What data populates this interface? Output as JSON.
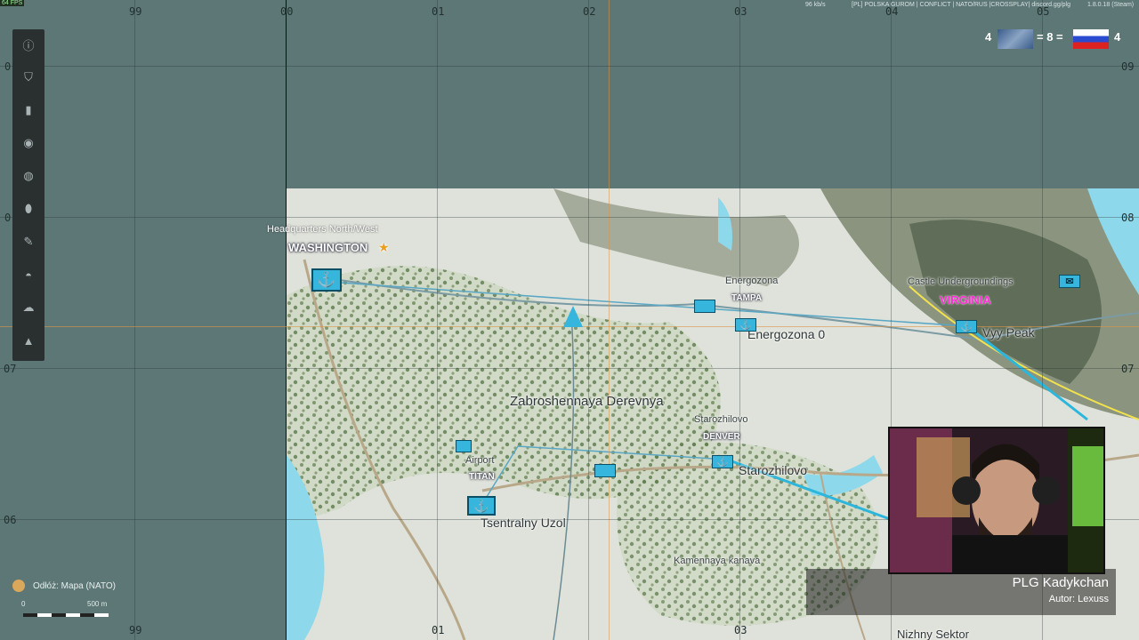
{
  "overlay": {
    "fps": "64 FPS",
    "server_info": "[PL] POLSKA GUROM | CONFLICT | NATO/RUS |CROSSPLAY| discord.gg/plg",
    "kbps": "96 kb/s",
    "version": "1.8.0.18 (Steam)"
  },
  "grid": {
    "top_labels": [
      "99",
      "00",
      "01",
      "02",
      "03",
      "04",
      "05"
    ],
    "bottom_labels": [
      "99",
      "01",
      "03"
    ],
    "left_labels": [
      "0",
      "0",
      "07",
      "06"
    ],
    "right_labels": [
      "09",
      "08",
      "07"
    ]
  },
  "score": {
    "nato_count": "4",
    "separator": "= 8 =",
    "rus_count": "4"
  },
  "toolbar": {
    "items": [
      "info-icon",
      "shield-icon",
      "ruler-icon",
      "compass-icon",
      "globe-icon",
      "marker-pin-icon",
      "pencil-icon",
      "eye-icon",
      "cloud-icon",
      "arrow-up-icon"
    ]
  },
  "map": {
    "labels": {
      "hq": "Headquarters North/West",
      "washington": "WASHINGTON",
      "energozona": "Energozona",
      "tampa": "TAMPA",
      "energozona0": "Energozona 0",
      "castle": "Castle Undergroundings",
      "virginia": "VIRGINIA",
      "peak": "Vyy Peak",
      "zabroshennaya": "Zabroshennaya Derevnya",
      "starozhilovo_small": "Starozhilovo",
      "denver": "DENVER",
      "starozhilovo": "Starozhilovo",
      "airport": "Airport",
      "titan": "TITAN",
      "tsentralny": "Tsentralny Uzol",
      "kamennaya": "Kamennaya kanava",
      "nizhny": "Nizhny Sektor"
    }
  },
  "legend": {
    "label": "Odłóż: Mapa (NATO)",
    "scale_start": "0",
    "scale_end": "500 m"
  },
  "stream": {
    "name": "PLG Kadykchan",
    "author": "Autor: Lexuss"
  },
  "colors": {
    "sea": "#5d7777",
    "friendly": "#36b6dc",
    "highlight": "#ff2ed6"
  }
}
